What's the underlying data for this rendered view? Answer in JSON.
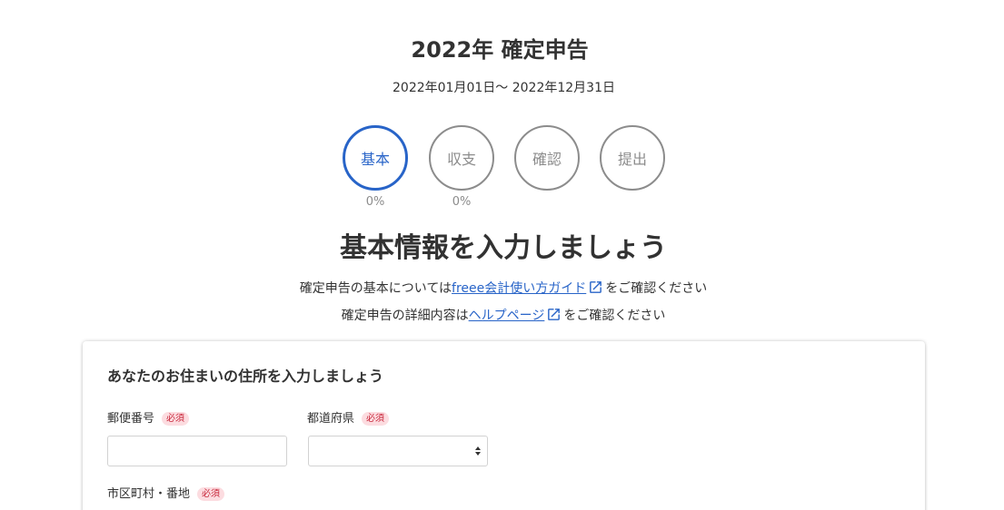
{
  "header": {
    "title": "2022年 確定申告",
    "period": "2022年01月01日～ 2022年12月31日"
  },
  "steps": [
    {
      "label": "基本",
      "progress": "0%",
      "active": true
    },
    {
      "label": "収支",
      "progress": "0%",
      "active": false
    },
    {
      "label": "確認",
      "active": false
    },
    {
      "label": "提出",
      "active": false
    }
  ],
  "main": {
    "heading": "基本情報を入力しましょう",
    "guide_line1_prefix": "確定申告の基本については",
    "guide_line1_link": "freee会計使い方ガイド",
    "guide_line1_suffix": "をご確認ください",
    "guide_line2_prefix": "確定申告の詳細内容は",
    "guide_line2_link": "ヘルプページ",
    "guide_line2_suffix": "をご確認ください"
  },
  "address_form": {
    "title": "あなたのお住まいの住所を入力しましょう",
    "postal_code_label": "郵便番号",
    "postal_code_value": "",
    "prefecture_label": "都道府県",
    "prefecture_value": "",
    "city_label": "市区町村・番地",
    "required_badge": "必須"
  },
  "colors": {
    "accent": "#2864c8",
    "text": "#323232",
    "inactive": "#8c8c8c",
    "required_text": "#c8283c",
    "required_bg": "#fcdce0"
  },
  "icons": {
    "external_link": "external-link-icon",
    "select_arrows": "select-arrows-icon"
  }
}
